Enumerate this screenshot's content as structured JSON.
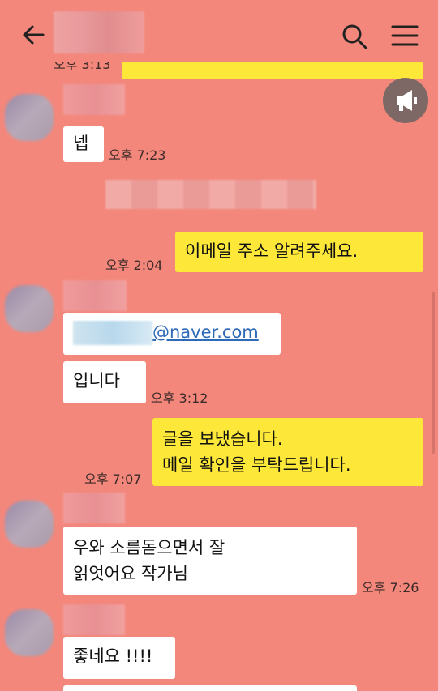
{
  "header": {
    "title": ""
  },
  "icons": {
    "back": "arrow-left-icon",
    "search": "search-icon",
    "menu": "hamburger-menu-icon",
    "notice": "megaphone-icon"
  },
  "partial_top": {
    "time": "오후 3:13"
  },
  "messages": {
    "m1": {
      "text": "넵",
      "time": "오후 7:23"
    },
    "m2": {
      "text": "이메일 주소 알려주세요.",
      "time": "오후 2:04"
    },
    "m3": {
      "email_domain": "@naver.com"
    },
    "m4": {
      "text": "입니다",
      "time": "오후 3:12"
    },
    "m5": {
      "line1": "글을 보냈습니다.",
      "line2": "메일 확인을 부탁드립니다.",
      "time": "오후 7:07"
    },
    "m6": {
      "line1": "우와 소름돋으면서 잘",
      "line2": "읽엇어요 작가님",
      "time": "오후 7:26"
    },
    "m7": {
      "text": "좋네요 !!!!"
    }
  },
  "colors": {
    "background": "#f4877b",
    "yellow_bubble": "#fde83a",
    "white_bubble": "#ffffff",
    "link": "#2d6ab8"
  }
}
